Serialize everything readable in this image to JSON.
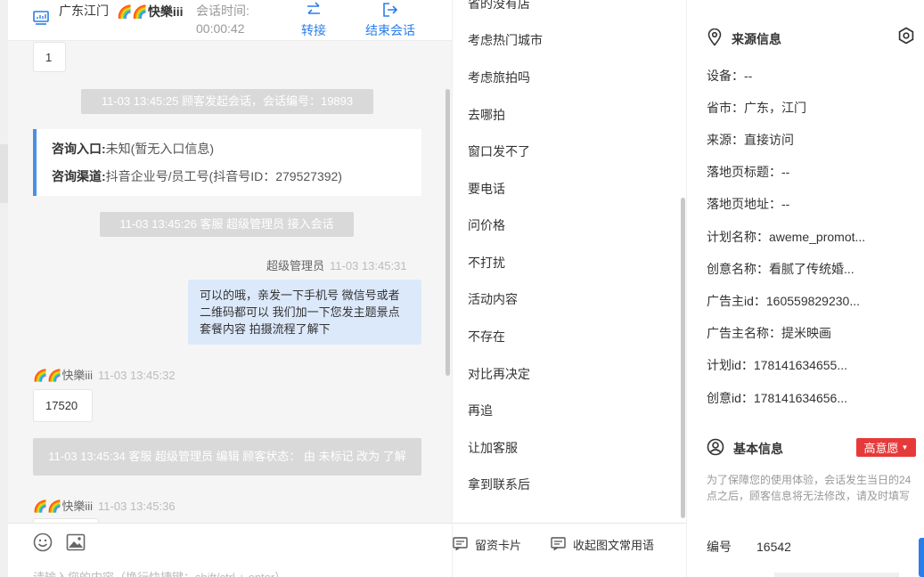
{
  "header": {
    "location": "广东江门",
    "customer_name": "🌈🌈快樂iii",
    "session_time_label": "会话时间:",
    "session_time": "00:00:42",
    "transfer_label": "转接",
    "end_label": "结束会话"
  },
  "chat": {
    "msg_top": "1",
    "sys1": "11-03 13:45:25 顾客发起会话，会话编号：19893",
    "card": {
      "entry_label": "咨询入口:",
      "entry_value": "未知(暂无入口信息)",
      "channel_label": "咨询渠道:",
      "channel_value": "抖音企业号/员工号(抖音号ID：279527392)"
    },
    "sys2": "11-03 13:45:26 客服 超级管理员 接入会话",
    "agent_name": "超级管理员",
    "agent_time": "11-03 13:45:31",
    "agent_msg": "可以的哦，亲发一下手机号 微信号或者二维码都可以 我们加一下您发主题景点 套餐内容 拍摄流程了解下",
    "cust_name": "🌈🌈快樂iii",
    "cust_time1": "11-03 13:45:32",
    "cust_msg1": "17520",
    "sys3": "11-03 13:45:34 客服 超级管理员 编辑 顾客状态： 由 未标记 改为 了解",
    "cust_time2": "11-03 13:45:36",
    "input_placeholder": "请输入您的内容（换行快捷键：shift/ctrl + enter）"
  },
  "phrases": {
    "items": [
      "省的没有店",
      "考虑热门城市",
      "考虑旅拍吗",
      "去哪拍",
      "窗口发不了",
      "要电话",
      "问价格",
      "不打扰",
      "活动内容",
      "不存在",
      "对比再决定",
      "再追",
      "让加客服",
      "拿到联系后"
    ],
    "card_label": "留资卡片",
    "collapse_label": "收起图文常用语"
  },
  "info": {
    "source_title": "来源信息",
    "fields": [
      "设备：--",
      "省市：广东，江门",
      "来源：直接访问",
      "落地页标题：--",
      "落地页地址：--",
      "计划名称：aweme_promot...",
      "创意名称：看腻了传统婚...",
      "广告主id：160559829230...",
      "广告主名称：提米映画",
      "计划id：178141634655...",
      "创意id：178141634656..."
    ],
    "basic_title": "基本信息",
    "intent_badge": "高意愿",
    "notice": "为了保障您的使用体验，会话发生当日的24点之后，顾客信息将无法修改，请及时填写",
    "number_label": "编号",
    "number_value": "16542"
  },
  "colors": {
    "accent": "#2b7de9",
    "badge": "#e63a3a",
    "agent_bubble": "#dce9fb",
    "card_border": "#4a90e2"
  },
  "icons": [
    "monitor-icon",
    "transfer-icon",
    "exit-icon",
    "emoji-icon",
    "image-icon",
    "card-icon",
    "collapse-icon",
    "location-pin-icon",
    "settings-icon",
    "user-icon"
  ]
}
